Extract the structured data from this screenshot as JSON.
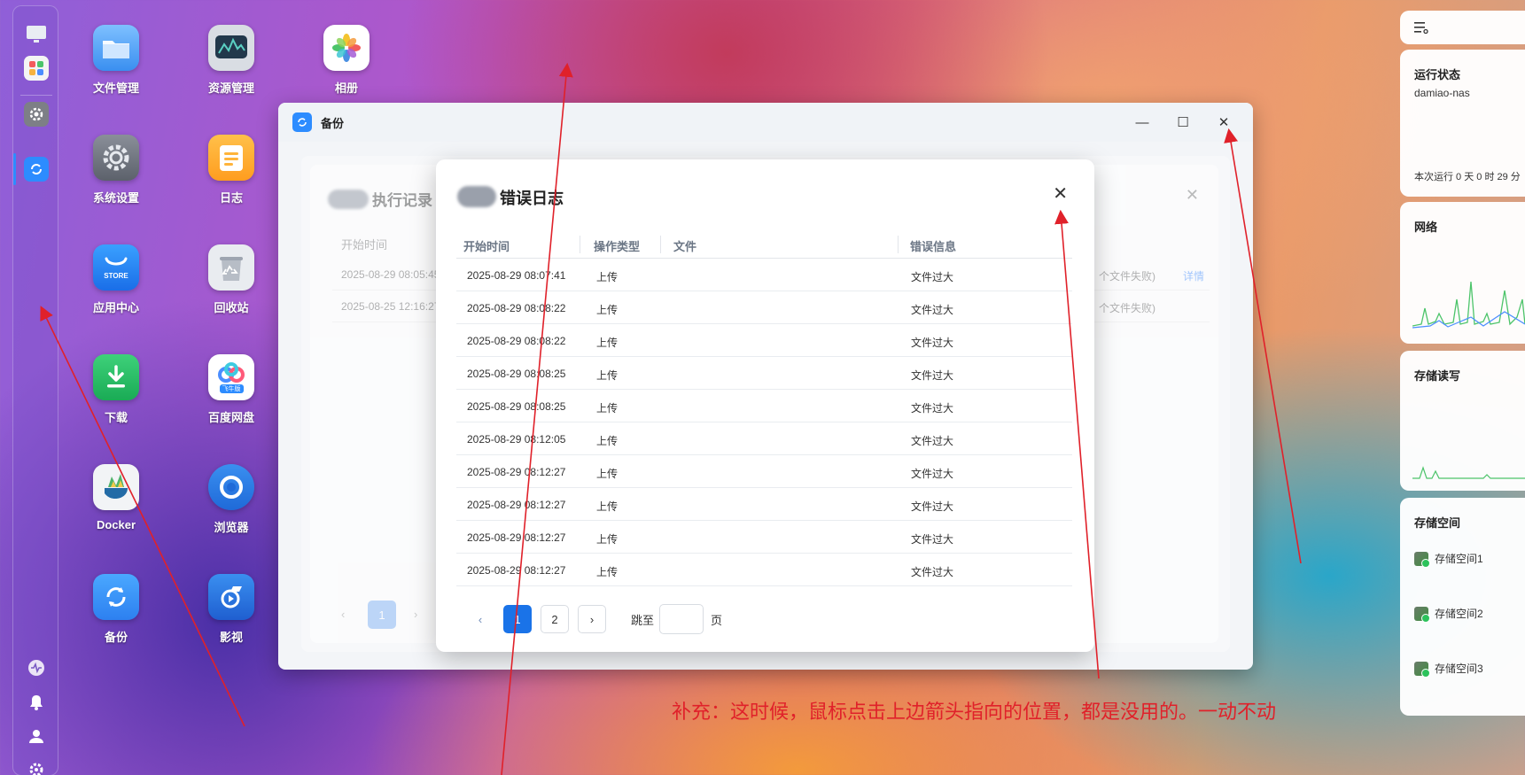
{
  "desktop_icons": [
    {
      "label": "文件管理",
      "icon": "folder-icon"
    },
    {
      "label": "资源管理",
      "icon": "monitor-chart-icon"
    },
    {
      "label": "相册",
      "icon": "photos-icon"
    },
    {
      "label": "系统设置",
      "icon": "gear-icon"
    },
    {
      "label": "日志",
      "icon": "notepad-icon"
    },
    {
      "label": "应用中心",
      "icon": "store-icon"
    },
    {
      "label": "回收站",
      "icon": "recycle-icon"
    },
    {
      "label": "下载",
      "icon": "download-icon"
    },
    {
      "label": "百度网盘",
      "icon": "baidu-netdisk-icon"
    },
    {
      "label": "Docker",
      "icon": "docker-icon"
    },
    {
      "label": "浏览器",
      "icon": "browser-icon"
    },
    {
      "label": "备份",
      "icon": "backup-icon"
    },
    {
      "label": "影视",
      "icon": "video-icon"
    }
  ],
  "store_badge": "STORE",
  "baidu_badge": "飞牛版",
  "window": {
    "title": "备份",
    "minimize": "—",
    "maximize": "☐",
    "close": "✕"
  },
  "exec_record": {
    "title": "执行记录",
    "close": "✕",
    "column_start": "开始时间",
    "rows": [
      {
        "time": "2025-08-29 08:05:45",
        "result": "个文件失败)",
        "detail": "详情"
      },
      {
        "time": "2025-08-25 12:16:27",
        "result": "个文件失败)",
        "detail": ""
      }
    ],
    "pager": {
      "prev": "‹",
      "page": "1",
      "next": "›"
    }
  },
  "error_log": {
    "title": "错误日志",
    "close": "✕",
    "columns": [
      "开始时间",
      "操作类型",
      "文件",
      "错误信息"
    ],
    "rows": [
      {
        "time": "2025-08-29 08:07:41",
        "op": "上传",
        "file": "",
        "error": "文件过大"
      },
      {
        "time": "2025-08-29 08:08:22",
        "op": "上传",
        "file": "",
        "error": "文件过大"
      },
      {
        "time": "2025-08-29 08:08:22",
        "op": "上传",
        "file": "",
        "error": "文件过大"
      },
      {
        "time": "2025-08-29 08:08:25",
        "op": "上传",
        "file": "",
        "error": "文件过大"
      },
      {
        "time": "2025-08-29 08:08:25",
        "op": "上传",
        "file": "",
        "error": "文件过大"
      },
      {
        "time": "2025-08-29 08:12:05",
        "op": "上传",
        "file": "",
        "error": "文件过大"
      },
      {
        "time": "2025-08-29 08:12:27",
        "op": "上传",
        "file": "",
        "error": "文件过大"
      },
      {
        "time": "2025-08-29 08:12:27",
        "op": "上传",
        "file": "",
        "error": "文件过大"
      },
      {
        "time": "2025-08-29 08:12:27",
        "op": "上传",
        "file": "",
        "error": "文件过大"
      },
      {
        "time": "2025-08-29 08:12:27",
        "op": "上传",
        "file": "",
        "error": "文件过大"
      }
    ],
    "pager": {
      "prev": "‹",
      "pages": [
        "1",
        "2"
      ],
      "current": "1",
      "next": "›",
      "jump_label": "跳至",
      "jump_value": "",
      "page_suffix": "页"
    }
  },
  "right_panel": {
    "status_title": "运行状态",
    "hostname": "damiao-nas",
    "uptime": "本次运行 0 天 0 时 29 分",
    "network_title": "网络",
    "storage_io_title": "存储读写",
    "storage_space_title": "存储空间",
    "volumes": [
      "存储空间1",
      "存储空间2",
      "存储空间3"
    ]
  },
  "annotation": {
    "text": "补充：这时候，鼠标点击上边箭头指向的位置，都是没用的。一动不动",
    "color": "#e0212a"
  },
  "colors": {
    "accent": "#1a73e8",
    "link": "#5b9dff"
  }
}
